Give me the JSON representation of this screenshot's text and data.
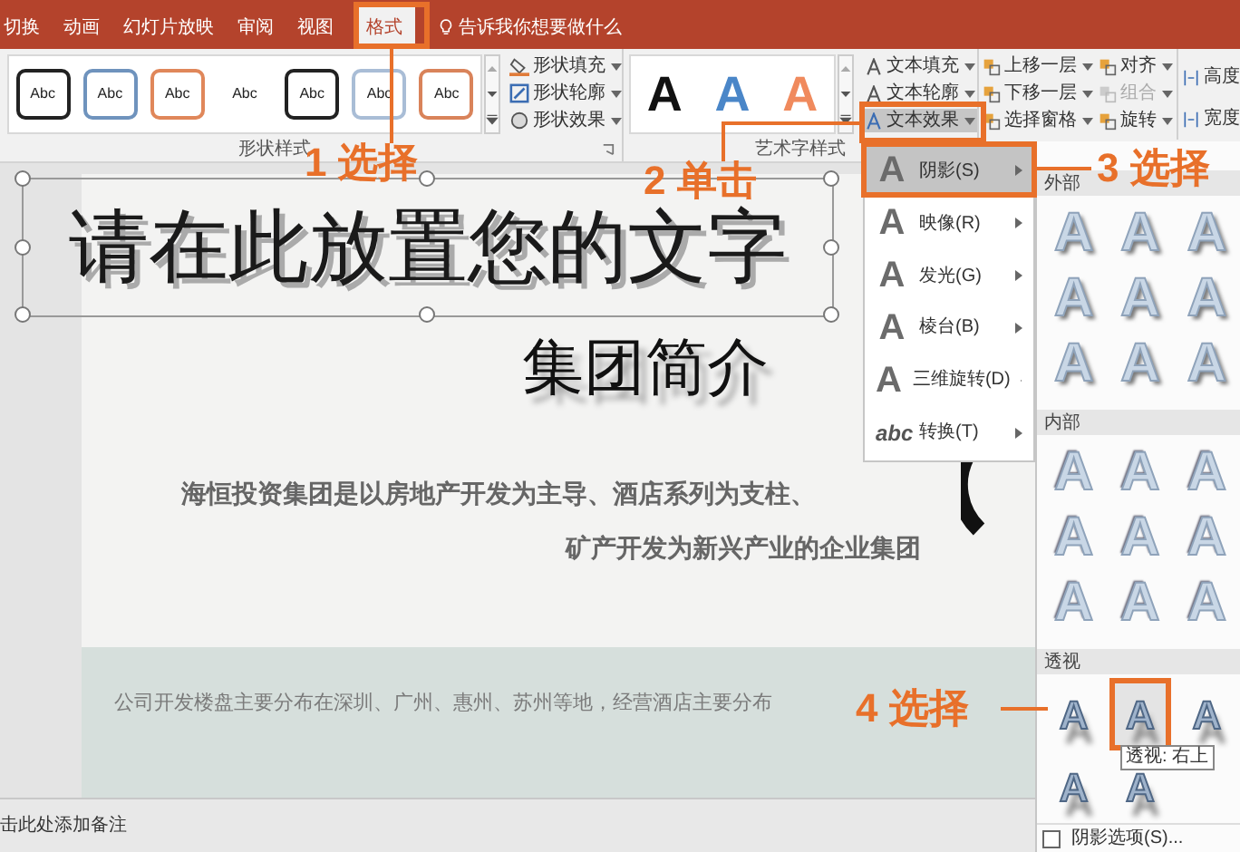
{
  "tabs": [
    {
      "label": "切换",
      "selected": false
    },
    {
      "label": "动画",
      "selected": false
    },
    {
      "label": "幻灯片放映",
      "selected": false
    },
    {
      "label": "审阅",
      "selected": false
    },
    {
      "label": "视图",
      "selected": false
    },
    {
      "label": "格式",
      "selected": true
    }
  ],
  "tell_me": "告诉我你想要做什么",
  "shape_styles": {
    "swatches": [
      {
        "label": "Abc",
        "kind": "outline",
        "color": "#222222"
      },
      {
        "label": "Abc",
        "kind": "outline",
        "color": "#6f93bd"
      },
      {
        "label": "Abc",
        "kind": "outline",
        "color": "#e0875a"
      },
      {
        "label": "Abc",
        "kind": "plain"
      },
      {
        "label": "Abc",
        "kind": "outline",
        "color": "#222222"
      },
      {
        "label": "Abc",
        "kind": "outline",
        "color": "#a9bdd6"
      },
      {
        "label": "Abc",
        "kind": "outline",
        "color": "#d9835a"
      }
    ],
    "commands": [
      {
        "label": "形状填充",
        "kind": "fill"
      },
      {
        "label": "形状轮廓",
        "kind": "outline"
      },
      {
        "label": "形状效果",
        "kind": "effect"
      }
    ],
    "group_label": "形状样式"
  },
  "wordart_styles": {
    "samples": [
      {
        "label": "A",
        "color": "#111111"
      },
      {
        "label": "A",
        "color": "#4a86c8"
      },
      {
        "label": "A",
        "color": "#f08a5d"
      }
    ],
    "commands": [
      {
        "label": "文本填充",
        "selected": false
      },
      {
        "label": "文本轮廓",
        "selected": false
      },
      {
        "label": "文本效果",
        "selected": true
      }
    ],
    "group_label": "艺术字样式"
  },
  "arrange": [
    {
      "label": "上移一层",
      "disabled": false
    },
    {
      "label": "对齐",
      "disabled": false
    },
    {
      "label": "下移一层",
      "disabled": false
    },
    {
      "label": "组合",
      "disabled": true
    },
    {
      "label": "选择窗格",
      "disabled": false
    },
    {
      "label": "旋转",
      "disabled": false
    }
  ],
  "size": [
    "高度",
    "宽度"
  ],
  "slide": {
    "title": "请在此放置您的文字",
    "subtitle": "集团简介",
    "paragraph": [
      "海恒投资集团是以房地产开发为主导、酒店系列为支柱、",
      "矿产开发为新兴产业的企业集团"
    ],
    "band_text": "公司开发楼盘主要分布在深圳、广州、惠州、苏州等地，经营酒店主要分布"
  },
  "notes": "击此处添加备注",
  "effects_menu": [
    {
      "icon": "A",
      "label": "阴影(S)",
      "selected": true
    },
    {
      "icon": "A",
      "label": "映像(R)",
      "selected": false
    },
    {
      "icon": "A",
      "label": "发光(G)",
      "selected": false
    },
    {
      "icon": "A",
      "label": "棱台(B)",
      "selected": false
    },
    {
      "icon": "A",
      "label": "三维旋转(D)",
      "selected": false
    },
    {
      "icon": "abc",
      "label": "转换(T)",
      "selected": false
    }
  ],
  "shadow_gallery": [
    {
      "title": "外部",
      "kind": "outer",
      "items": [
        {
          "label": "A",
          "selected": false
        },
        {
          "label": "A",
          "selected": false
        },
        {
          "label": "A",
          "selected": false
        },
        {
          "label": "A",
          "selected": false
        },
        {
          "label": "A",
          "selected": false
        },
        {
          "label": "A",
          "selected": false
        },
        {
          "label": "A",
          "selected": false
        },
        {
          "label": "A",
          "selected": false
        },
        {
          "label": "A",
          "selected": false
        }
      ]
    },
    {
      "title": "内部",
      "kind": "inner",
      "items": [
        {
          "label": "A",
          "selected": false
        },
        {
          "label": "A",
          "selected": false
        },
        {
          "label": "A",
          "selected": false
        },
        {
          "label": "A",
          "selected": false
        },
        {
          "label": "A",
          "selected": false
        },
        {
          "label": "A",
          "selected": false
        },
        {
          "label": "A",
          "selected": false
        },
        {
          "label": "A",
          "selected": false
        },
        {
          "label": "A",
          "selected": false
        }
      ]
    },
    {
      "title": "透视",
      "kind": "perspective",
      "items": [
        {
          "label": "A",
          "selected": false
        },
        {
          "label": "A",
          "selected": true
        },
        {
          "label": "A",
          "selected": false
        },
        {
          "label": "A",
          "selected": false
        },
        {
          "label": "A",
          "selected": false
        }
      ]
    }
  ],
  "tooltip": "透视: 右上",
  "shadow_options": {
    "label": "阴影选项(S)...",
    "checked": false
  },
  "annotations": [
    "1 选择",
    "2 单击",
    "3 选择",
    "4 选择"
  ]
}
